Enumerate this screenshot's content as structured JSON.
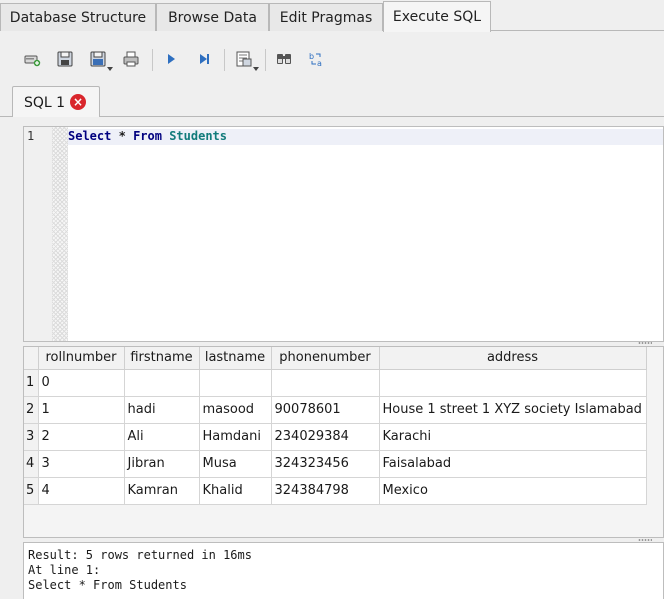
{
  "tabs": [
    {
      "label": "Database Structure"
    },
    {
      "label": "Browse Data"
    },
    {
      "label": "Edit Pragmas"
    },
    {
      "label": "Execute SQL"
    }
  ],
  "active_tab": "Execute SQL",
  "toolbar": {
    "icons": [
      "open-tab-icon",
      "open-sql-file-icon",
      "save-sql-file-icon",
      "print-icon",
      "execute-all-icon",
      "execute-current-line-icon",
      "save-results-icon",
      "find-icon",
      "find-replace-icon"
    ]
  },
  "sql_tab": {
    "label": "SQL 1"
  },
  "editor": {
    "line_number": "1",
    "keyword_select": "Select",
    "star": "*",
    "keyword_from": "From",
    "table": "Students"
  },
  "results": {
    "columns": [
      "rollnumber",
      "firstname",
      "lastname",
      "phonenumber",
      "address"
    ],
    "rows": [
      {
        "num": "1",
        "cells": [
          "0",
          "",
          "",
          "",
          ""
        ]
      },
      {
        "num": "2",
        "cells": [
          "1",
          "hadi",
          "masood",
          "90078601",
          "House 1 street 1 XYZ society Islamabad"
        ]
      },
      {
        "num": "3",
        "cells": [
          "2",
          "Ali",
          "Hamdani",
          "234029384",
          "Karachi"
        ]
      },
      {
        "num": "4",
        "cells": [
          "3",
          "Jibran",
          "Musa",
          "324323456",
          "Faisalabad"
        ]
      },
      {
        "num": "5",
        "cells": [
          "4",
          "Kamran",
          "Khalid",
          "324384798",
          "Mexico"
        ]
      }
    ]
  },
  "messages": {
    "line1": "Result: 5 rows returned in 16ms",
    "line2": "At line 1:",
    "line3": "Select * From Students"
  }
}
